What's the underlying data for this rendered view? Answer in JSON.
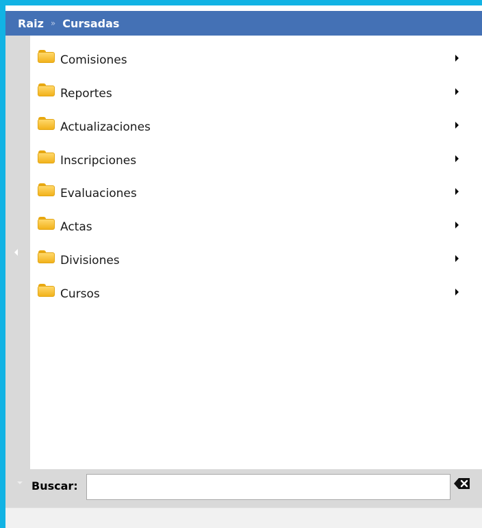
{
  "breadcrumb": {
    "root": "Raiz",
    "separator": "»",
    "current": "Cursadas"
  },
  "menu": {
    "items": [
      {
        "label": "Comisiones",
        "icon": "folder-icon"
      },
      {
        "label": "Reportes",
        "icon": "folder-icon"
      },
      {
        "label": "Actualizaciones",
        "icon": "folder-icon"
      },
      {
        "label": "Inscripciones",
        "icon": "folder-icon"
      },
      {
        "label": "Evaluaciones",
        "icon": "folder-icon"
      },
      {
        "label": "Actas",
        "icon": "folder-icon"
      },
      {
        "label": "Divisiones",
        "icon": "folder-icon"
      },
      {
        "label": "Cursos",
        "icon": "folder-icon"
      }
    ]
  },
  "search": {
    "label": "Buscar:",
    "value": "",
    "placeholder": ""
  },
  "colors": {
    "background": "#12b3e4",
    "header": "#4471b5",
    "strip": "#d9d9d9",
    "folder": "#f2b21c"
  },
  "icons": {
    "collapse": "chevron-left-icon",
    "submenu": "caret-right-icon",
    "expand": "chevron-down-icon",
    "clear": "backspace-icon"
  }
}
